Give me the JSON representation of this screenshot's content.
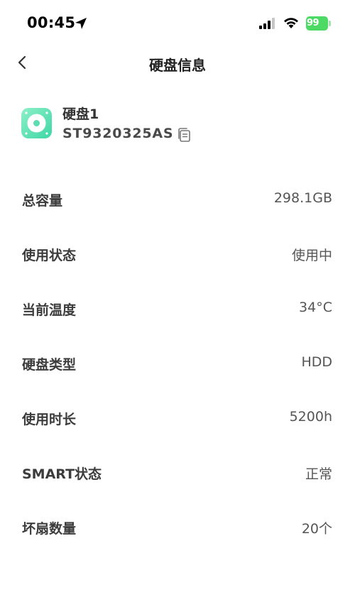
{
  "status_bar": {
    "time": "00:45",
    "battery": "99"
  },
  "nav": {
    "title": "硬盘信息"
  },
  "disk": {
    "name": "硬盘1",
    "model": "ST9320325AS"
  },
  "info": [
    {
      "label": "总容量",
      "value": "298.1GB"
    },
    {
      "label": "使用状态",
      "value": "使用中"
    },
    {
      "label": "当前温度",
      "value": "34°C"
    },
    {
      "label": "硬盘类型",
      "value": "HDD"
    },
    {
      "label": "使用时长",
      "value": "5200h"
    },
    {
      "label": "SMART状态",
      "value": "正常"
    },
    {
      "label": "坏扇数量",
      "value": "20个"
    }
  ],
  "colors": {
    "accent": "#3dd6a6",
    "battery": "#4cd964"
  }
}
